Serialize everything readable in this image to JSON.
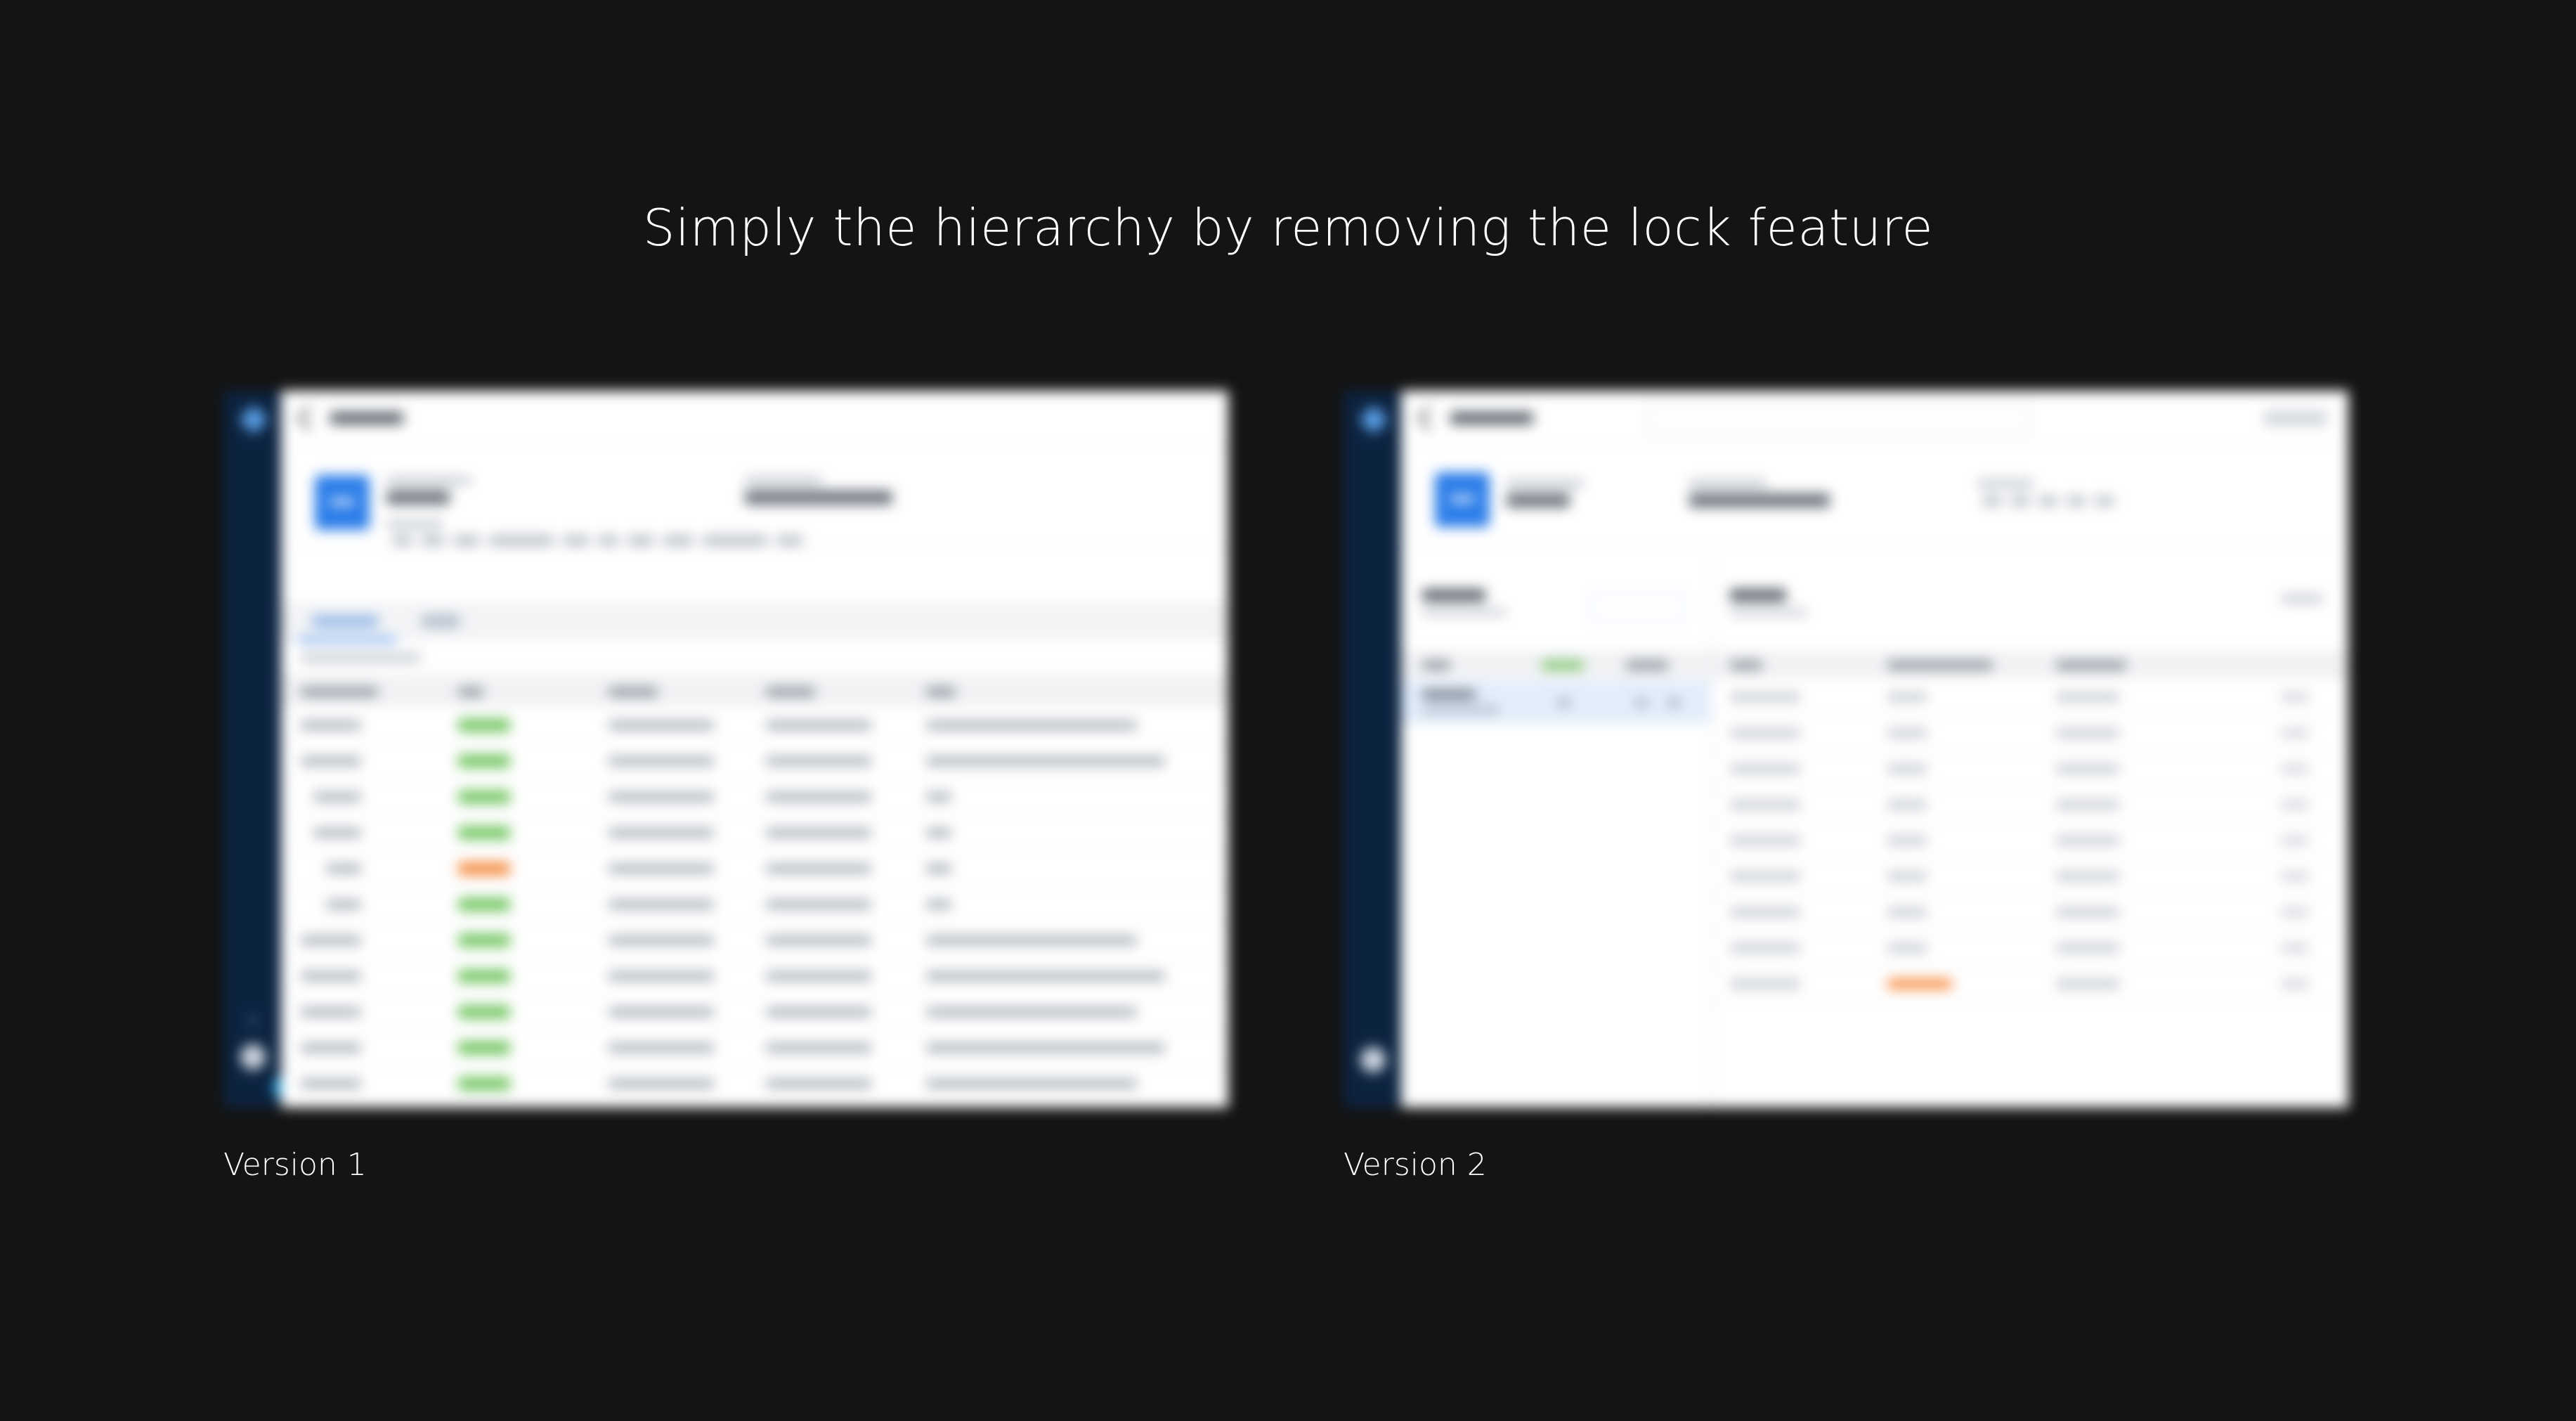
{
  "headline": "Simply the hierarchy by removing the lock feature",
  "versions": [
    {
      "caption": "Version 1",
      "table_rows": [
        {
          "status": "ok"
        },
        {
          "status": "ok"
        },
        {
          "status": "ok"
        },
        {
          "status": "ok"
        },
        {
          "status": "warn"
        },
        {
          "status": "ok"
        },
        {
          "status": "ok"
        },
        {
          "status": "ok"
        },
        {
          "status": "ok"
        },
        {
          "status": "ok"
        },
        {
          "status": "ok"
        }
      ]
    },
    {
      "caption": "Version 2",
      "list_rows": [
        {
          "status": "none"
        },
        {
          "status": "none"
        },
        {
          "status": "none"
        },
        {
          "status": "none"
        },
        {
          "status": "none"
        },
        {
          "status": "none"
        },
        {
          "status": "none"
        },
        {
          "status": "none"
        },
        {
          "status": "warn"
        }
      ]
    }
  ],
  "colors": {
    "background": "#141414",
    "sidebar": "#0c2340",
    "accent": "#2b7de9",
    "status_ok": "#6cc35a",
    "status_warn": "#f4883a"
  },
  "icons": {
    "rail_logo": "diamond-logo-icon",
    "back": "chevron-left-icon",
    "user": "avatar-icon",
    "chat": "chat-bubble-icon"
  }
}
